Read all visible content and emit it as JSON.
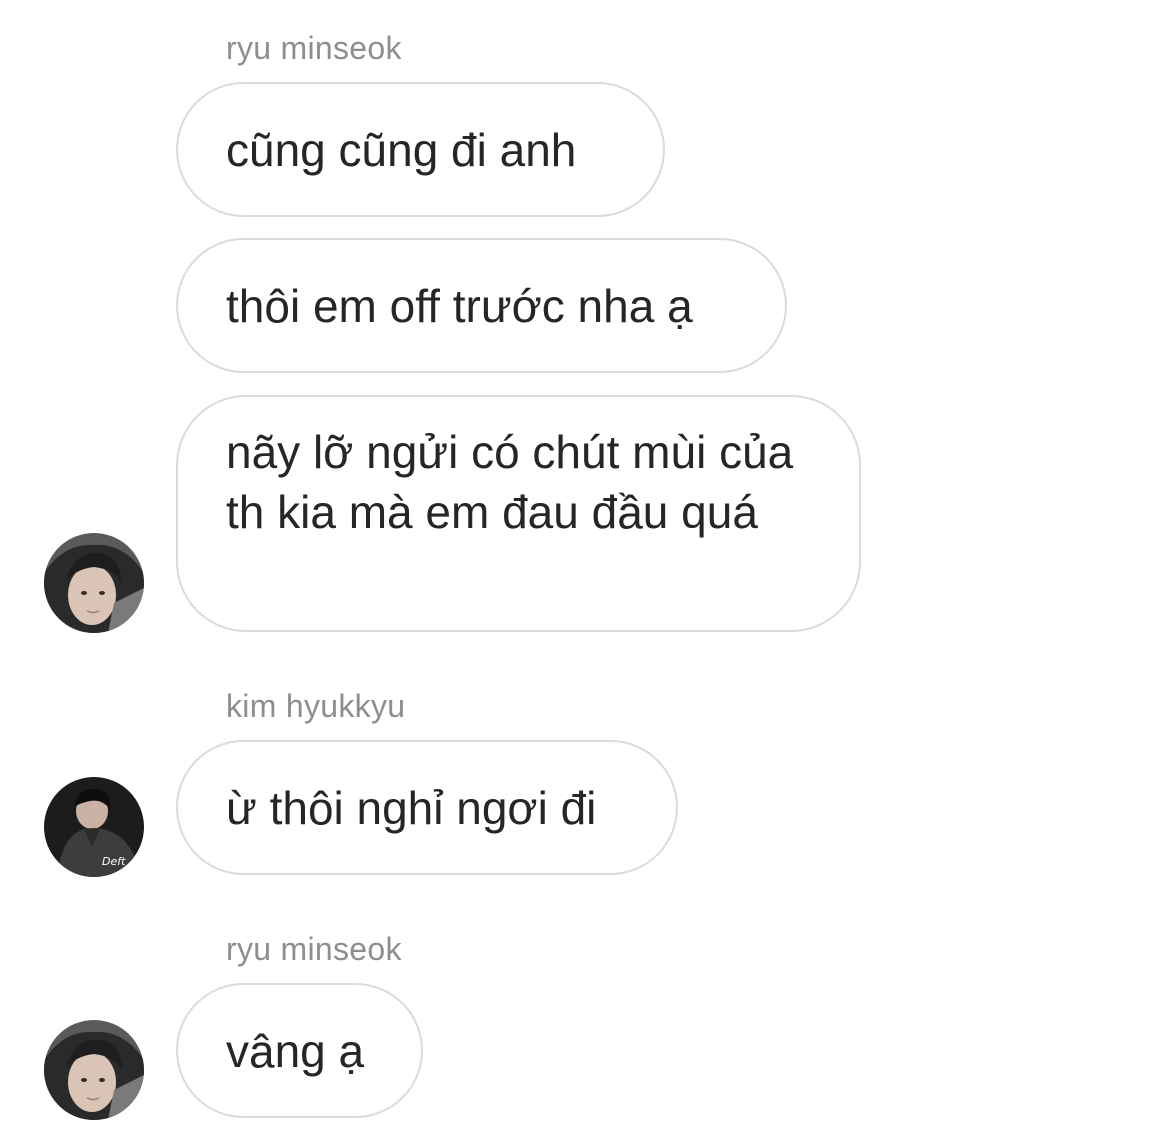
{
  "thread": {
    "group1": {
      "sender": "ryu minseok",
      "messages": [
        "cũng cũng đi anh",
        "thôi em off trước nha ạ",
        "nãy lỡ ngửi có chút mùi của th kia mà em đau đầu quá"
      ]
    },
    "group2": {
      "sender": "kim hyukkyu",
      "messages": [
        "ừ thôi nghỉ ngơi đi"
      ],
      "avatar_badge": "Deft"
    },
    "group3": {
      "sender": "ryu minseok",
      "messages": [
        "vâng ạ"
      ]
    }
  },
  "icons": {
    "avatar_minseok": "user-avatar-photo",
    "avatar_hyukkyu": "user-avatar-photo"
  }
}
